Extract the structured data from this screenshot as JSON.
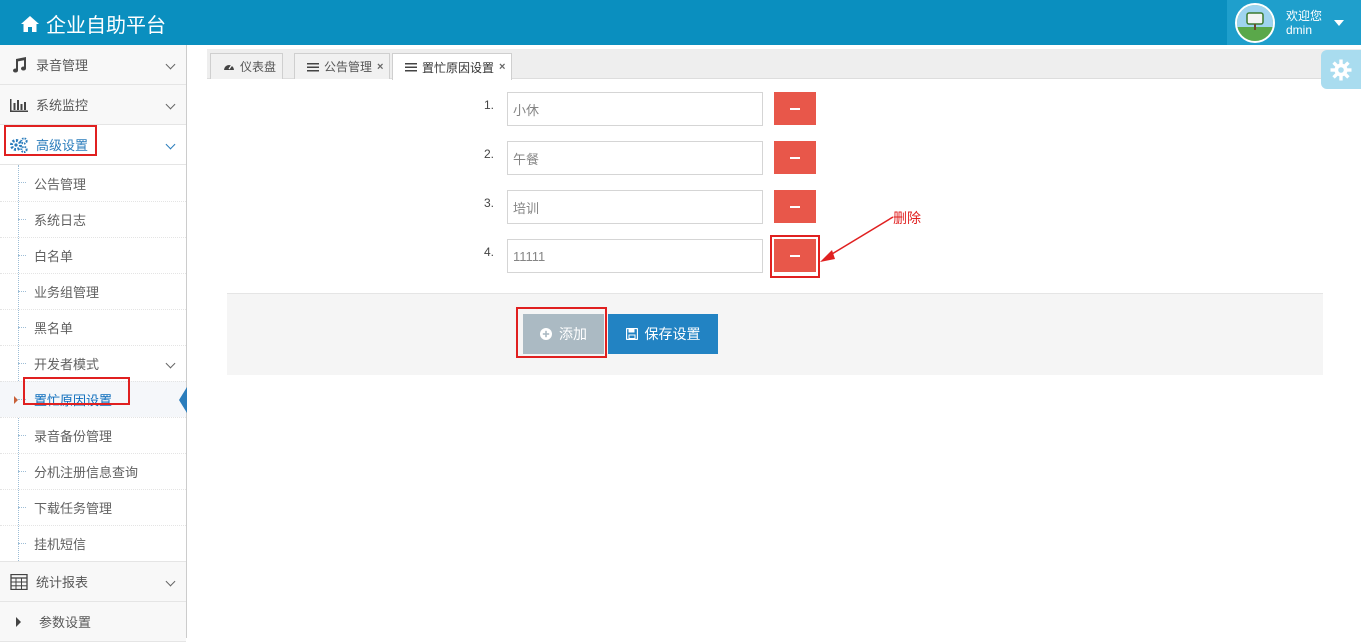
{
  "header": {
    "title": "企业自助平台",
    "welcome": "欢迎您",
    "username": "dmin"
  },
  "sidebar": {
    "items": [
      {
        "label": "录音管理",
        "icon": "music-icon"
      },
      {
        "label": "系统监控",
        "icon": "bar-chart-icon"
      },
      {
        "label": "高级设置",
        "icon": "gears-icon"
      }
    ],
    "submenu": [
      {
        "label": "公告管理"
      },
      {
        "label": "系统日志"
      },
      {
        "label": "白名单"
      },
      {
        "label": "业务组管理"
      },
      {
        "label": "黑名单"
      },
      {
        "label": "开发者模式"
      },
      {
        "label": "置忙原因设置"
      },
      {
        "label": "录音备份管理"
      },
      {
        "label": "分机注册信息查询"
      },
      {
        "label": "下载任务管理"
      },
      {
        "label": "挂机短信"
      }
    ],
    "bottom_items": [
      {
        "label": "统计报表",
        "icon": "calculator-icon"
      },
      {
        "label": "参数设置",
        "icon": "caret-right-icon"
      }
    ]
  },
  "tabs": [
    {
      "label": "仪表盘",
      "icon": "dashboard-icon"
    },
    {
      "label": "公告管理",
      "icon": "list-icon",
      "close": "×"
    },
    {
      "label": "置忙原因设置",
      "icon": "list-icon",
      "close": "×"
    }
  ],
  "form": {
    "rows": [
      {
        "num": "1.",
        "value": "小休"
      },
      {
        "num": "2.",
        "value": "午餐"
      },
      {
        "num": "3.",
        "value": "培训"
      },
      {
        "num": "4.",
        "value": "11111"
      }
    ],
    "annotation": "删除",
    "add_label": "添加",
    "save_label": "保存设置"
  },
  "colors": {
    "navbar": "#0a8fbf",
    "delete_button": "#e8574a",
    "save_button": "#2283c3",
    "add_button": "#abbac3",
    "annotation": "#e02020"
  }
}
